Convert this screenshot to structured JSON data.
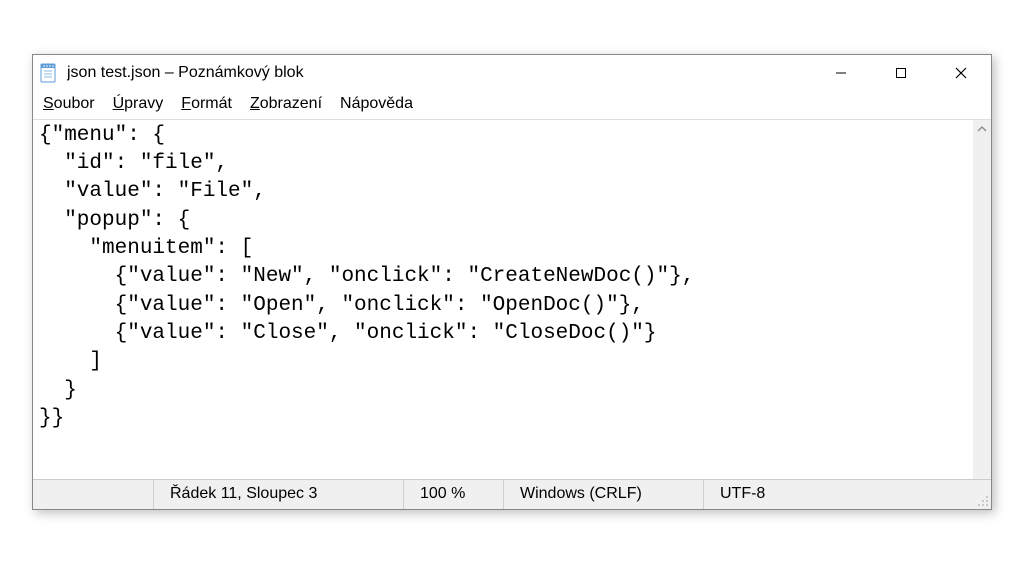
{
  "titlebar": {
    "title": "json test.json – Poznámkový blok"
  },
  "menubar": {
    "items": [
      {
        "label": "Soubor",
        "accel_index": 0
      },
      {
        "label": "Úpravy",
        "accel_index": 0
      },
      {
        "label": "Formát",
        "accel_index": 0
      },
      {
        "label": "Zobrazení",
        "accel_index": 0
      },
      {
        "label": "Nápověda",
        "accel_index": -1
      }
    ]
  },
  "editor": {
    "content": "{\"menu\": {\n  \"id\": \"file\",\n  \"value\": \"File\",\n  \"popup\": {\n    \"menuitem\": [\n      {\"value\": \"New\", \"onclick\": \"CreateNewDoc()\"},\n      {\"value\": \"Open\", \"onclick\": \"OpenDoc()\"},\n      {\"value\": \"Close\", \"onclick\": \"CloseDoc()\"}\n    ]\n  }\n}}"
  },
  "statusbar": {
    "linecol": "Řádek 11, Sloupec 3",
    "zoom": "100 %",
    "eol": "Windows (CRLF)",
    "encoding": "UTF-8"
  }
}
